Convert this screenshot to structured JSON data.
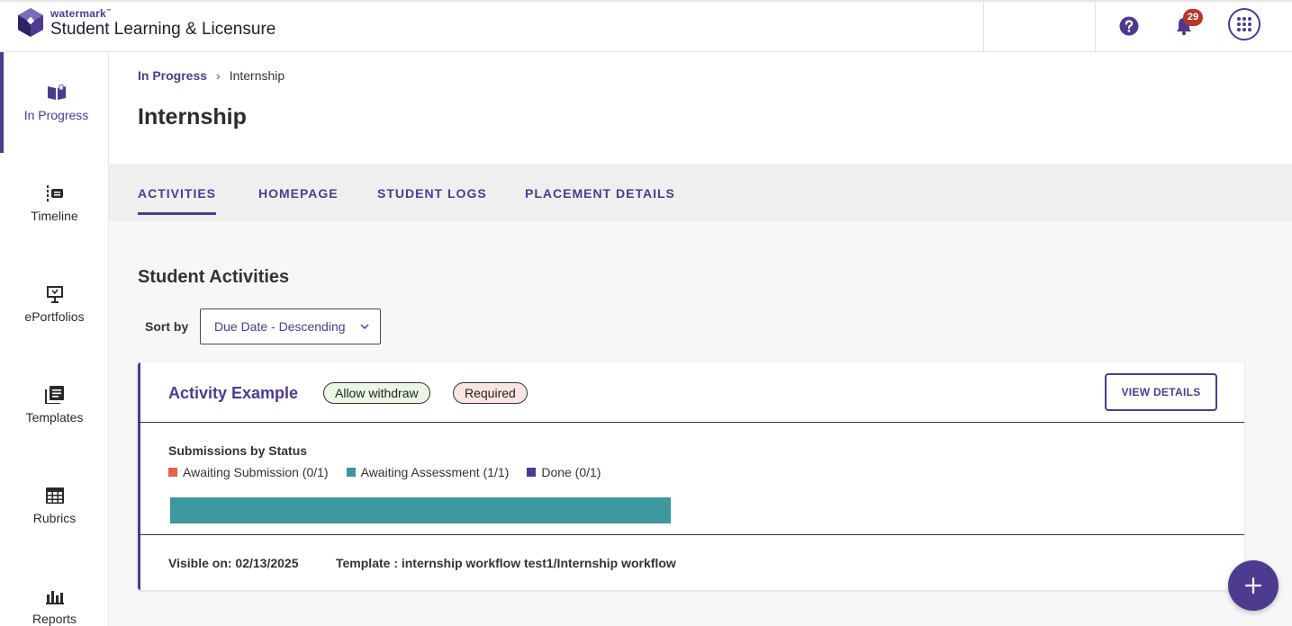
{
  "app": {
    "brand": "watermark",
    "trademark": "™",
    "product": "Student Learning & Licensure"
  },
  "topbar": {
    "help_icon": "help-circle-icon",
    "notifications_icon": "bell-icon",
    "notifications_count": "29",
    "apps_icon": "grid-dots-icon"
  },
  "sidebar": {
    "items": [
      {
        "label": "In Progress",
        "icon": "open-book-icon",
        "active": true
      },
      {
        "label": "Timeline",
        "icon": "timeline-icon",
        "active": false
      },
      {
        "label": "ePortfolios",
        "icon": "presentation-board-icon",
        "active": false
      },
      {
        "label": "Templates",
        "icon": "stacked-docs-icon",
        "active": false
      },
      {
        "label": "Rubrics",
        "icon": "table-grid-icon",
        "active": false
      },
      {
        "label": "Reports",
        "icon": "bar-chart-icon",
        "active": false
      }
    ]
  },
  "breadcrumb": {
    "parent": "In Progress",
    "separator": "›",
    "current": "Internship"
  },
  "page": {
    "title": "Internship"
  },
  "tabs": [
    {
      "label": "ACTIVITIES",
      "active": true
    },
    {
      "label": "HOMEPAGE",
      "active": false
    },
    {
      "label": "STUDENT LOGS",
      "active": false
    },
    {
      "label": "PLACEMENT DETAILS",
      "active": false
    }
  ],
  "activities": {
    "section_title": "Student Activities",
    "sort_label": "Sort by",
    "sort_value": "Due Date - Descending"
  },
  "card": {
    "title": "Activity Example",
    "tags": [
      "Allow withdraw",
      "Required"
    ],
    "view_button": "VIEW DETAILS",
    "submissions_title": "Submissions by Status",
    "statuses": [
      {
        "label": "Awaiting Submission (0/1)",
        "color": "#e8604c",
        "count": 0,
        "total": 1
      },
      {
        "label": "Awaiting Assessment (1/1)",
        "color": "#3d979e",
        "count": 1,
        "total": 1
      },
      {
        "label": "Done (0/1)",
        "color": "#4d3b8f",
        "count": 0,
        "total": 1
      }
    ],
    "visible_on": "Visible on: 02/13/2025",
    "template": "Template : internship workflow test1/Internship workflow"
  },
  "fab": {
    "icon": "plus-icon"
  },
  "colors": {
    "accent": "#4d3b8f",
    "badge": "#b8362a"
  }
}
